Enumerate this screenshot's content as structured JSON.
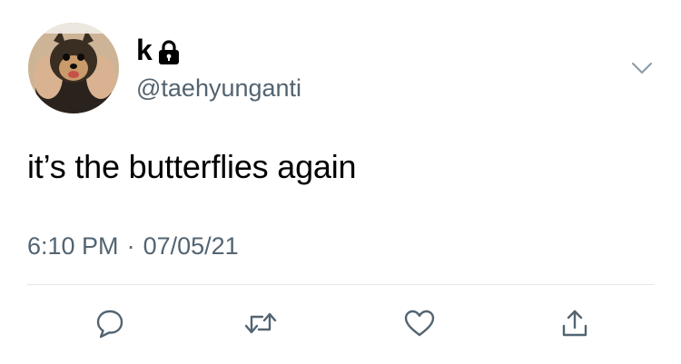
{
  "user": {
    "display_name": "k",
    "handle": "@taehyunganti",
    "protected": true
  },
  "tweet": {
    "text": "it’s the butterflies again",
    "time": "6:10 PM",
    "separator": "·",
    "date": "07/05/21"
  },
  "actions": [
    {
      "name": "reply",
      "icon": "speech-bubble-icon"
    },
    {
      "name": "retweet",
      "icon": "retweet-arrows-icon"
    },
    {
      "name": "like",
      "icon": "heart-icon"
    },
    {
      "name": "share",
      "icon": "share-up-arrow-icon"
    }
  ],
  "colors": {
    "text": "#000000",
    "secondary": "#536471",
    "divider": "#e1e8ed",
    "icon": "#536471"
  }
}
